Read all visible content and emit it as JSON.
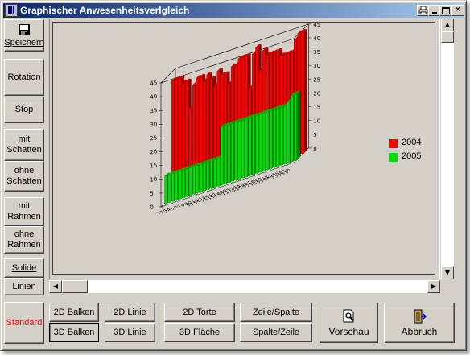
{
  "window": {
    "title": "Graphischer Anwesenheitsverlgleich",
    "controls": [
      "printer-icon",
      "minimize-icon",
      "maximize-icon",
      "close-icon"
    ]
  },
  "sidebar": {
    "save_label": "Speichern",
    "rotation_label": "Rotation",
    "stop_label": "Stop",
    "shadow_on": [
      "mit",
      "Schatten"
    ],
    "shadow_off": [
      "ohne",
      "Schatten"
    ],
    "frame_on": [
      "mit",
      "Rahmen"
    ],
    "frame_off": [
      "ohne",
      "Rahmen"
    ],
    "solid_label": "Solide",
    "lines_label": "Linien",
    "standard_label": "Standard"
  },
  "bottom_bar": {
    "bar2d": "2D Balken",
    "bar3d": "3D Balken",
    "line2d": "2D Linie",
    "line3d": "3D Linie",
    "pie2d": "2D Torte",
    "area3d": "3D Fläche",
    "row_col": "Zeile/Spalte",
    "col_row": "Spalte/Zeile",
    "preview": "Vorschau",
    "cancel": "Abbruch"
  },
  "colors": {
    "series_2004": "#ff0000",
    "series_2005": "#00e000",
    "accent_red_text": "#ff0000"
  },
  "chart_data": {
    "type": "bar",
    "style": "3d-bar",
    "legend_position": "right",
    "ylim": [
      0,
      45
    ],
    "yticks": [
      0,
      5,
      10,
      15,
      20,
      25,
      30,
      35,
      40,
      45
    ],
    "categories": [
      "1",
      "2",
      "3",
      "4",
      "5",
      "6",
      "7",
      "8",
      "9",
      "10",
      "11",
      "12",
      "13",
      "14",
      "15",
      "16",
      "17",
      "18",
      "19",
      "20",
      "21",
      "22",
      "23",
      "24",
      "25",
      "26",
      "27",
      "28",
      "29",
      "30",
      "31",
      "32",
      "33",
      "34",
      "35",
      "36",
      "37",
      "38"
    ],
    "series": [
      {
        "name": "2004",
        "color": "#ff0000",
        "values": [
          42,
          42,
          42,
          40,
          40,
          30,
          38,
          40,
          40,
          38,
          40,
          38,
          35,
          40,
          38,
          38,
          34,
          40,
          40,
          42,
          42,
          42,
          30,
          42,
          44,
          35,
          42,
          40,
          40,
          40,
          40,
          38,
          38,
          38,
          38,
          42,
          44,
          44
        ]
      },
      {
        "name": "2005",
        "color": "#00e000",
        "values": [
          10,
          10,
          10,
          10,
          10,
          10,
          10,
          10,
          10,
          10,
          10,
          10,
          10,
          10,
          10,
          10,
          21,
          21,
          21,
          21,
          21,
          21,
          21,
          21,
          21,
          21,
          21,
          21,
          21,
          21,
          21,
          21,
          21,
          21,
          21,
          22,
          24,
          24
        ]
      }
    ]
  }
}
